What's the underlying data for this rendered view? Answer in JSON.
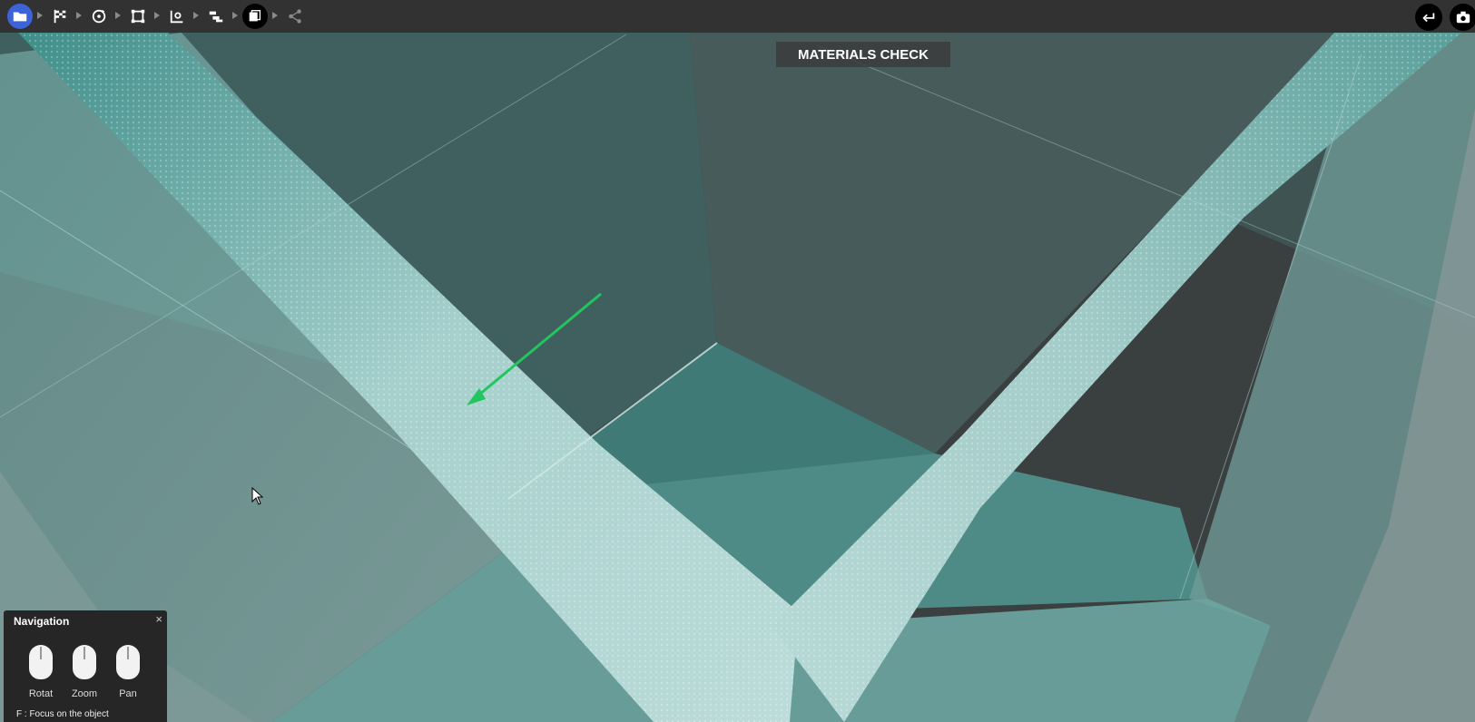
{
  "toolbar": {
    "tools": [
      {
        "icon": "folder-icon",
        "state": "active"
      },
      {
        "icon": "checkered-flag-icon"
      },
      {
        "icon": "rotate-icon"
      },
      {
        "icon": "frame-icon"
      },
      {
        "icon": "inspect-icon"
      },
      {
        "icon": "layers-icon"
      },
      {
        "icon": "materials-icon",
        "state": "current"
      },
      {
        "icon": "share-icon"
      }
    ],
    "right_buttons": [
      "undo-icon",
      "camera-icon"
    ],
    "colors": {
      "active": "#3d63d8",
      "current": "#000000"
    }
  },
  "viewport": {
    "mode_title": "MATERIALS CHECK",
    "annotation_arrow_color": "#22c55e"
  },
  "navigation": {
    "title": "Navigation",
    "close": "×",
    "controls": [
      {
        "label": "Rotat",
        "icon": "mouse-left-click-icon"
      },
      {
        "label": "Zoom",
        "icon": "mouse-scroll-icon"
      },
      {
        "label": "Pan",
        "icon": "mouse-right-click-icon"
      }
    ],
    "hint": "F : Focus on the object"
  }
}
